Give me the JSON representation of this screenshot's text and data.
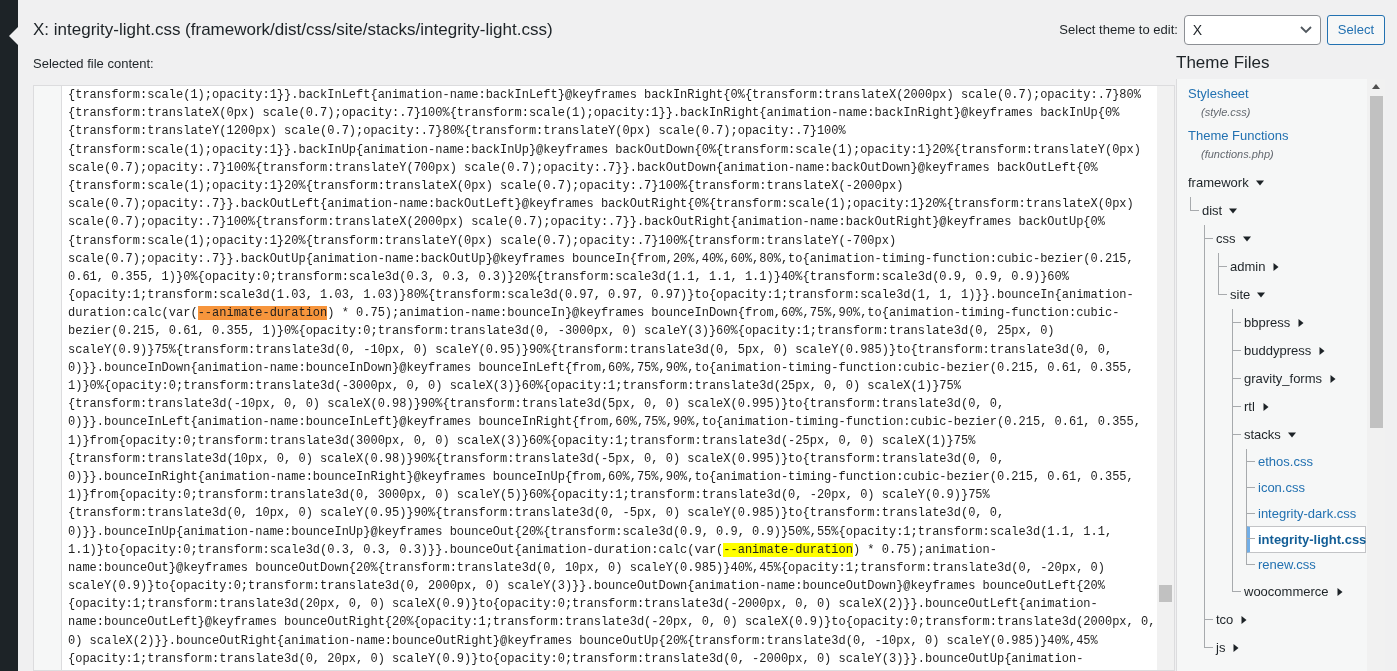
{
  "title": "X: integrity-light.css (framework/dist/css/site/stacks/integrity-light.css)",
  "theme_select": {
    "label": "Select theme to edit:",
    "value": "X",
    "button": "Select"
  },
  "editor": {
    "label": "Selected file content:",
    "lines": [
      [
        "{transform:scale(1);opacity:1}}.backInLeft{animation-name:backInLeft}@keyframes backInRight{0%{transform:translateX(2000px) scale(0.7);opacity:.7}80%"
      ],
      [
        "{transform:translateX(0px) scale(0.7);opacity:.7}100%{transform:scale(1);opacity:1}}.backInRight{animation-name:backInRight}@keyframes backInUp{0%"
      ],
      [
        "{transform:translateY(1200px) scale(0.7);opacity:.7}80%{transform:translateY(0px) scale(0.7);opacity:.7}100%"
      ],
      [
        "{transform:scale(1);opacity:1}}.backInUp{animation-name:backInUp}@keyframes backOutDown{0%{transform:scale(1);opacity:1}20%{transform:translateY(0px)"
      ],
      [
        "scale(0.7);opacity:.7}100%{transform:translateY(700px) scale(0.7);opacity:.7}}.backOutDown{animation-name:backOutDown}@keyframes backOutLeft{0%"
      ],
      [
        "{transform:scale(1);opacity:1}20%{transform:translateX(0px) scale(0.7);opacity:.7}100%{transform:translateX(-2000px)"
      ],
      [
        "scale(0.7);opacity:.7}}.backOutLeft{animation-name:backOutLeft}@keyframes backOutRight{0%{transform:scale(1);opacity:1}20%{transform:translateX(0px)"
      ],
      [
        "scale(0.7);opacity:.7}100%{transform:translateX(2000px) scale(0.7);opacity:.7}}.backOutRight{animation-name:backOutRight}@keyframes backOutUp{0%"
      ],
      [
        "{transform:scale(1);opacity:1}20%{transform:translateY(0px) scale(0.7);opacity:.7}100%{transform:translateY(-700px)"
      ],
      [
        "scale(0.7);opacity:.7}}.backOutUp{animation-name:backOutUp}@keyframes bounceIn{from,20%,40%,60%,80%,to{animation-timing-function:cubic-bezier(0.215,"
      ],
      [
        "0.61, 0.355, 1)}0%{opacity:0;transform:scale3d(0.3, 0.3, 0.3)}20%{transform:scale3d(1.1, 1.1, 1.1)}40%{transform:scale3d(0.9, 0.9, 0.9)}60%"
      ],
      [
        "{opacity:1;transform:scale3d(1.03, 1.03, 1.03)}80%{transform:scale3d(0.97, 0.97, 0.97)}to{opacity:1;transform:scale3d(1, 1, 1)}}.bounceIn{animation-"
      ],
      [
        "duration:calc(var(",
        {
          "text": "--animate-duration",
          "color": "#f7953c"
        },
        ") * 0.75);animation-name:bounceIn}@keyframes bounceInDown{from,60%,75%,90%,to{animation-timing-function:cubic-"
      ],
      [
        "bezier(0.215, 0.61, 0.355, 1)}0%{opacity:0;transform:translate3d(0, -3000px, 0) scaleY(3)}60%{opacity:1;transform:translate3d(0, 25px, 0)"
      ],
      [
        "scaleY(0.9)}75%{transform:translate3d(0, -10px, 0) scaleY(0.95)}90%{transform:translate3d(0, 5px, 0) scaleY(0.985)}to{transform:translate3d(0, 0,"
      ],
      [
        "0)}}.bounceInDown{animation-name:bounceInDown}@keyframes bounceInLeft{from,60%,75%,90%,to{animation-timing-function:cubic-bezier(0.215, 0.61, 0.355,"
      ],
      [
        "1)}0%{opacity:0;transform:translate3d(-3000px, 0, 0) scaleX(3)}60%{opacity:1;transform:translate3d(25px, 0, 0) scaleX(1)}75%"
      ],
      [
        "{transform:translate3d(-10px, 0, 0) scaleX(0.98)}90%{transform:translate3d(5px, 0, 0) scaleX(0.995)}to{transform:translate3d(0, 0,"
      ],
      [
        "0)}}.bounceInLeft{animation-name:bounceInLeft}@keyframes bounceInRight{from,60%,75%,90%,to{animation-timing-function:cubic-bezier(0.215, 0.61, 0.355,"
      ],
      [
        "1)}from{opacity:0;transform:translate3d(3000px, 0, 0) scaleX(3)}60%{opacity:1;transform:translate3d(-25px, 0, 0) scaleX(1)}75%"
      ],
      [
        "{transform:translate3d(10px, 0, 0) scaleX(0.98)}90%{transform:translate3d(-5px, 0, 0) scaleX(0.995)}to{transform:translate3d(0, 0,"
      ],
      [
        "0)}}.bounceInRight{animation-name:bounceInRight}@keyframes bounceInUp{from,60%,75%,90%,to{animation-timing-function:cubic-bezier(0.215, 0.61, 0.355,"
      ],
      [
        "1)}from{opacity:0;transform:translate3d(0, 3000px, 0) scaleY(5)}60%{opacity:1;transform:translate3d(0, -20px, 0) scaleY(0.9)}75%"
      ],
      [
        "{transform:translate3d(0, 10px, 0) scaleY(0.95)}90%{transform:translate3d(0, -5px, 0) scaleY(0.985)}to{transform:translate3d(0, 0,"
      ],
      [
        "0)}}.bounceInUp{animation-name:bounceInUp}@keyframes bounceOut{20%{transform:scale3d(0.9, 0.9, 0.9)}50%,55%{opacity:1;transform:scale3d(1.1, 1.1,"
      ],
      [
        "1.1)}to{opacity:0;transform:scale3d(0.3, 0.3, 0.3)}}.bounceOut{animation-duration:calc(var(",
        {
          "text": "--animate-duration",
          "color": "#ffff00"
        },
        ") * 0.75);animation-"
      ],
      [
        "name:bounceOut}@keyframes bounceOutDown{20%{transform:translate3d(0, 10px, 0) scaleY(0.985)}40%,45%{opacity:1;transform:translate3d(0, -20px, 0)"
      ],
      [
        "scaleY(0.9)}to{opacity:0;transform:translate3d(0, 2000px, 0) scaleY(3)}}.bounceOutDown{animation-name:bounceOutDown}@keyframes bounceOutLeft{20%"
      ],
      [
        "{opacity:1;transform:translate3d(20px, 0, 0) scaleX(0.9)}to{opacity:0;transform:translate3d(-2000px, 0, 0) scaleX(2)}}.bounceOutLeft{animation-"
      ],
      [
        "name:bounceOutLeft}@keyframes bounceOutRight{20%{opacity:1;transform:translate3d(-20px, 0, 0) scaleX(0.9)}to{opacity:0;transform:translate3d(2000px, 0,"
      ],
      [
        "0) scaleX(2)}}.bounceOutRight{animation-name:bounceOutRight}@keyframes bounceOutUp{20%{transform:translate3d(0, -10px, 0) scaleY(0.985)}40%,45%"
      ],
      [
        "{opacity:1;transform:translate3d(0, 20px, 0) scaleY(0.9)}to{opacity:0;transform:translate3d(0, -2000px, 0) scaleY(3)}}.bounceOutUp{animation-"
      ]
    ]
  },
  "theme_files": {
    "title": "Theme Files",
    "templates": [
      {
        "label": "Stylesheet",
        "filename": "(style.css)"
      },
      {
        "label": "Theme Functions",
        "filename": "(functions.php)"
      }
    ],
    "tree": [
      {
        "name": "framework",
        "kind": "folder",
        "expanded": true,
        "children": [
          {
            "name": "dist",
            "kind": "folder",
            "expanded": true,
            "children": [
              {
                "name": "css",
                "kind": "folder",
                "expanded": true,
                "children": [
                  {
                    "name": "admin",
                    "kind": "folder",
                    "expanded": false
                  },
                  {
                    "name": "site",
                    "kind": "folder",
                    "expanded": true,
                    "children": [
                      {
                        "name": "bbpress",
                        "kind": "folder",
                        "expanded": false
                      },
                      {
                        "name": "buddypress",
                        "kind": "folder",
                        "expanded": false
                      },
                      {
                        "name": "gravity_forms",
                        "kind": "folder",
                        "expanded": false
                      },
                      {
                        "name": "rtl",
                        "kind": "folder",
                        "expanded": false
                      },
                      {
                        "name": "stacks",
                        "kind": "folder",
                        "expanded": true,
                        "children": [
                          {
                            "name": "ethos.css",
                            "kind": "file",
                            "selected": false
                          },
                          {
                            "name": "icon.css",
                            "kind": "file",
                            "selected": false
                          },
                          {
                            "name": "integrity-dark.css",
                            "kind": "file",
                            "selected": false
                          },
                          {
                            "name": "integrity-light.css",
                            "kind": "file",
                            "selected": true
                          },
                          {
                            "name": "renew.css",
                            "kind": "file",
                            "selected": false
                          }
                        ]
                      },
                      {
                        "name": "woocommerce",
                        "kind": "folder",
                        "expanded": false
                      }
                    ]
                  }
                ]
              },
              {
                "name": "tco",
                "kind": "folder",
                "expanded": false
              },
              {
                "name": "js",
                "kind": "folder",
                "expanded": false
              }
            ]
          }
        ]
      }
    ]
  }
}
